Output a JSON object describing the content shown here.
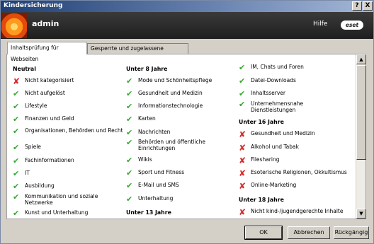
{
  "window": {
    "title": "Kindersicherung",
    "help_button": "?",
    "close_button": "X"
  },
  "header": {
    "user": "admin",
    "help_link": "Hilfe",
    "brand": "eset"
  },
  "tabs": [
    {
      "label": "Inhaltsprüfung für Webseiten",
      "active": true
    },
    {
      "label": "Gesperrte und zugelassene Webseiten",
      "active": false
    }
  ],
  "columns": [
    {
      "heading": "Neutral",
      "items": [
        {
          "label": "Nicht kategorisiert",
          "status": "blocked"
        },
        {
          "label": "Nicht aufgelöst",
          "status": "allowed"
        },
        {
          "label": "Lifestyle",
          "status": "allowed"
        },
        {
          "label": "Finanzen und Geld",
          "status": "allowed"
        },
        {
          "label": "Organisationen, Behörden und Recht",
          "status": "allowed"
        },
        {
          "label": "Spiele",
          "status": "allowed"
        },
        {
          "label": "Fachinformationen",
          "status": "allowed"
        },
        {
          "label": "IT",
          "status": "allowed"
        },
        {
          "label": "Ausbildung",
          "status": "allowed"
        },
        {
          "label": "Kommunikation und soziale Netzwerke",
          "status": "allowed"
        },
        {
          "label": "Kunst und Unterhaltung",
          "status": "allowed"
        }
      ]
    },
    {
      "heading": "Unter 8 Jahre",
      "items": [
        {
          "label": "Mode und Schönheitspflege",
          "status": "allowed"
        },
        {
          "label": "Gesundheit und Medizin",
          "status": "allowed"
        },
        {
          "label": "Informationstechnologie",
          "status": "allowed"
        },
        {
          "label": "Karten",
          "status": "allowed"
        },
        {
          "label": "Nachrichten",
          "status": "allowed"
        },
        {
          "label": "Behörden und öffentliche Einrichtungen",
          "status": "allowed"
        },
        {
          "label": "Wikis",
          "status": "allowed"
        },
        {
          "label": "Sport und Fitness",
          "status": "allowed"
        },
        {
          "label": "E-Mail und SMS",
          "status": "allowed"
        },
        {
          "label": "Unterhaltung",
          "status": "allowed"
        }
      ],
      "heading2": "Unter 13 Jahre"
    },
    {
      "items_top": [
        {
          "label": "IM, Chats und Foren",
          "status": "allowed"
        },
        {
          "label": "Datei-Downloads",
          "status": "allowed"
        },
        {
          "label": "Inhaltsserver",
          "status": "allowed"
        },
        {
          "label": "Unternehmensnahe Dienstleistungen",
          "status": "allowed"
        }
      ],
      "heading": "Unter 16 Jahre",
      "items": [
        {
          "label": "Gesundheit und Medizin",
          "status": "blocked"
        },
        {
          "label": "Alkohol und Tabak",
          "status": "blocked"
        },
        {
          "label": "Filesharing",
          "status": "blocked"
        },
        {
          "label": "Esoterische Religionen, Okkultismus",
          "status": "blocked"
        },
        {
          "label": "Online-Marketing",
          "status": "blocked"
        }
      ],
      "heading2": "Unter 18 Jahre",
      "items2": [
        {
          "label": "Nicht kind-/jugendgerechte Inhalte",
          "status": "blocked"
        }
      ]
    }
  ],
  "buttons": {
    "ok": "OK",
    "cancel": "Abbrechen",
    "reset": "Rückgängig"
  },
  "scrollbar": {
    "up": "▲",
    "down": "▼"
  },
  "icons": {
    "allowed": "✔",
    "blocked": "✘"
  },
  "colors": {
    "allowed": "#37a630",
    "blocked": "#d42d2d"
  }
}
